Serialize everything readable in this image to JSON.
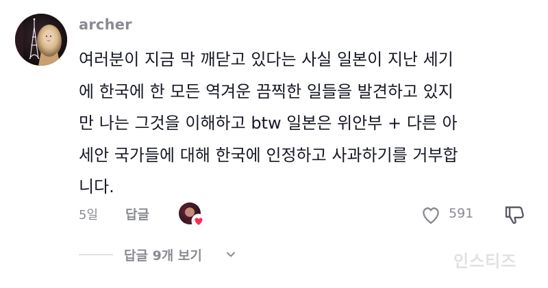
{
  "comment": {
    "username": "archer",
    "body_lines": [
      "여러분이 지금 막 깨닫고 있다는 사실 일본이 지난 세기",
      "에 한국에 한 모든 역겨운 끔찍한 일들을 발견하고 있지",
      "만 나는 그것을 이해하고 btw 일본은 위안부 + 다른 아",
      "세안 국가들에 대해 한국에 인정하고 사과하기를 거부합",
      "니다."
    ],
    "time": "5일",
    "reply_label": "답글",
    "like_count": "591",
    "view_replies_label": "답글 9개 보기"
  },
  "watermark": "인스티즈",
  "colors": {
    "text": "#161823",
    "muted": "#8a8b91",
    "heart": "#fe2c55"
  },
  "icons": {
    "like": "heart-outline-icon",
    "dislike": "thumbs-down-icon",
    "chevron": "chevron-down-icon",
    "creator_liked": "creator-liked-heart-icon"
  }
}
